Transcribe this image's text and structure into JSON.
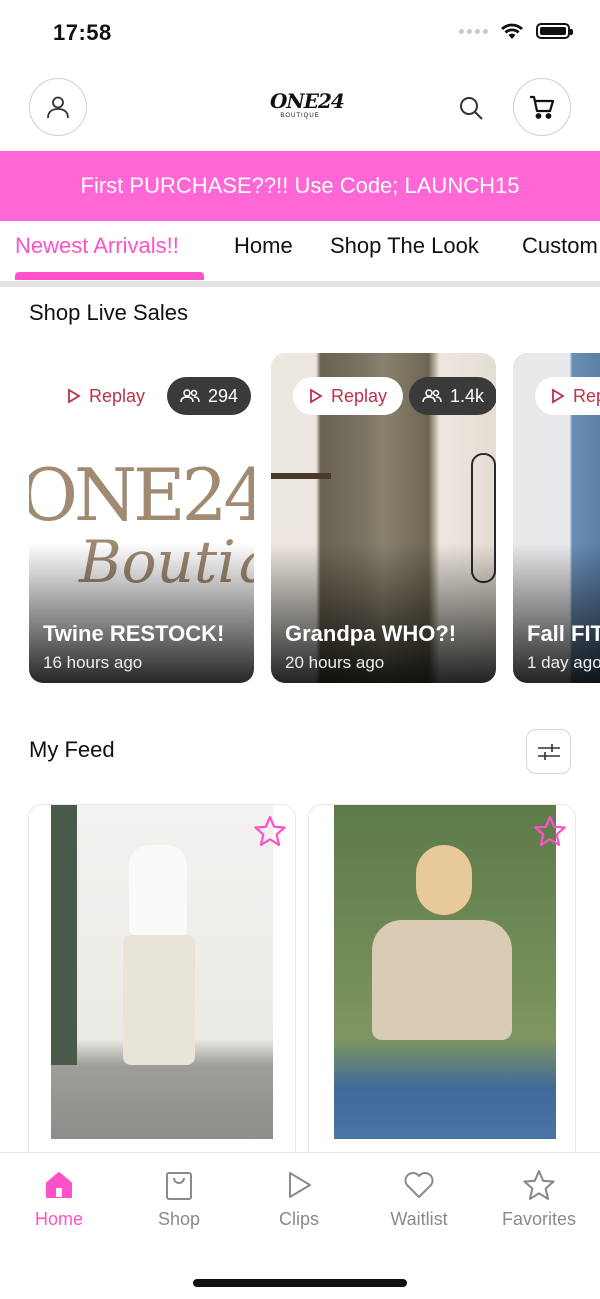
{
  "status": {
    "time": "17:58"
  },
  "header": {
    "logo_main": "ONE24",
    "logo_sub": "BOUTIQUE"
  },
  "promo": {
    "text": "First PURCHASE??!! Use Code; LAUNCH15",
    "color": "#ff66d6"
  },
  "tabs": [
    {
      "label": "Newest Arrivals!!",
      "active": true
    },
    {
      "label": "Home"
    },
    {
      "label": "Shop The Look"
    },
    {
      "label": "Custom"
    }
  ],
  "live_sales": {
    "title": "Shop Live Sales",
    "cards": [
      {
        "replay": "Replay",
        "viewers": "294",
        "title": "Twine RESTOCK!",
        "time": "16 hours ago",
        "bg_text_1": "ONE24",
        "bg_text_2": "Boutique"
      },
      {
        "replay": "Replay",
        "viewers": "1.4k",
        "title": "Grandpa WHO?!",
        "time": "20 hours ago"
      },
      {
        "replay": "Replay",
        "title": "Fall FIT",
        "time": "1 day ago"
      }
    ]
  },
  "feed": {
    "title": "My Feed"
  },
  "nav": [
    {
      "label": "Home",
      "icon": "home-icon",
      "active": true
    },
    {
      "label": "Shop",
      "icon": "shopping-bag-icon"
    },
    {
      "label": "Clips",
      "icon": "play-icon"
    },
    {
      "label": "Waitlist",
      "icon": "heart-icon"
    },
    {
      "label": "Favorites",
      "icon": "star-icon"
    }
  ],
  "colors": {
    "accent": "#ff52c8",
    "replay_red": "#c0304a"
  }
}
